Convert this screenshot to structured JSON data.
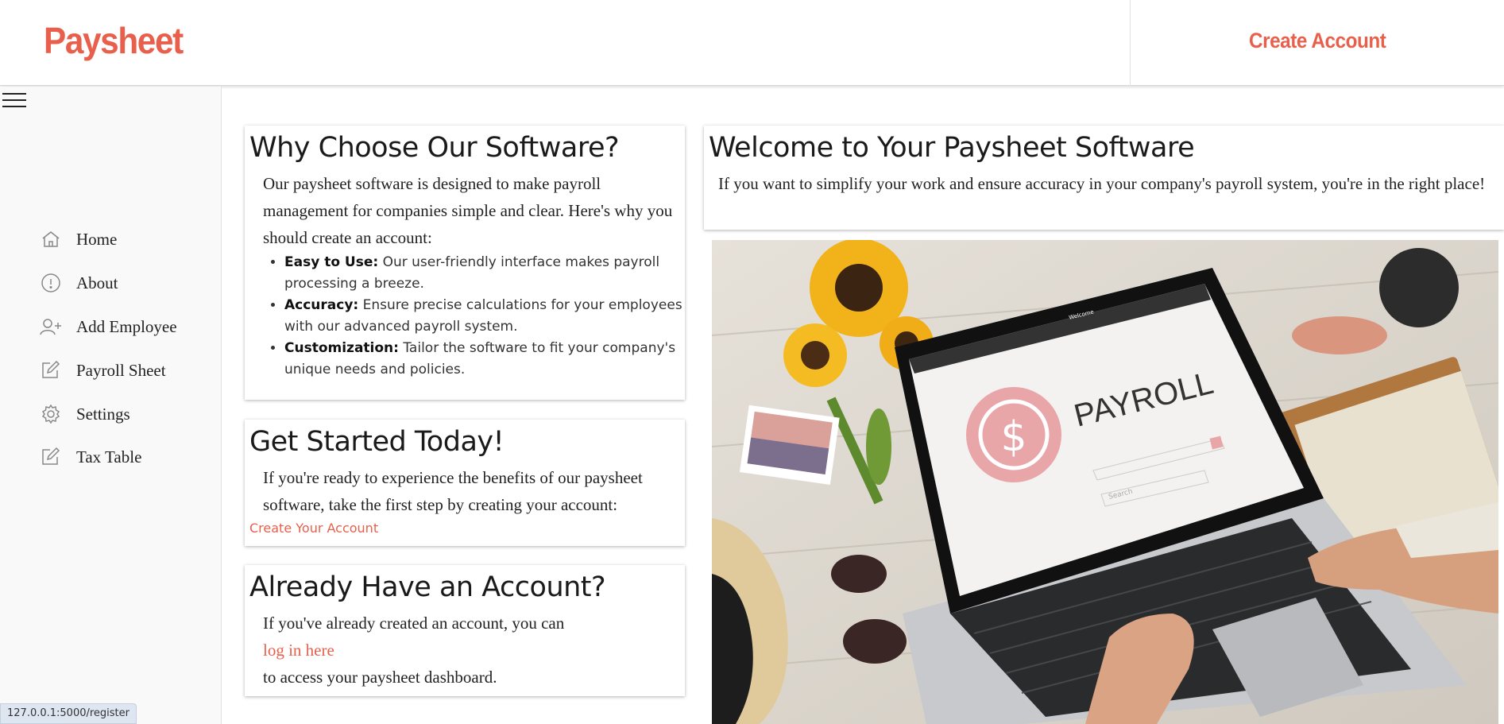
{
  "header": {
    "logo": "Paysheet",
    "create_account": "Create Account"
  },
  "sidebar": {
    "items": [
      {
        "label": "Home",
        "icon": "home-icon"
      },
      {
        "label": "About",
        "icon": "info-icon"
      },
      {
        "label": "Add Employee",
        "icon": "add-user-icon"
      },
      {
        "label": "Payroll Sheet",
        "icon": "edit-icon"
      },
      {
        "label": "Settings",
        "icon": "gear-icon"
      },
      {
        "label": "Tax Table",
        "icon": "edit-icon"
      }
    ]
  },
  "why": {
    "title": "Why Choose Our Software?",
    "intro": "Our paysheet software is designed to make payroll management for companies simple and clear. Here's why you should create an account:",
    "points": [
      {
        "bold": "Easy to Use:",
        "text": " Our user-friendly interface makes payroll processing a breeze."
      },
      {
        "bold": "Accuracy:",
        "text": " Ensure precise calculations for your employees with our advanced payroll system."
      },
      {
        "bold": "Customization:",
        "text": " Tailor the software to fit your company's unique needs and policies."
      }
    ]
  },
  "started": {
    "title": "Get Started Today!",
    "text": "If you're ready to experience the benefits of our paysheet software, take the first step by creating your account:",
    "link": "Create Your Account"
  },
  "already": {
    "title": "Already Have an Account?",
    "text1": "If you've already created an account, you can",
    "link": "log in here",
    "text2": "to access your paysheet dashboard."
  },
  "welcome": {
    "title": "Welcome to Your Paysheet Software",
    "text": "If you want to simplify your work and ensure accuracy in your company's payroll system, you're in the right place!"
  },
  "hero": {
    "screen_word": "PAYROLL",
    "screen_search": "Search",
    "screen_top": "Welcome"
  },
  "status_url": "127.0.0.1:5000/register",
  "colors": {
    "accent": "#e8604c",
    "sidebar_bg": "#f9f9f9"
  }
}
